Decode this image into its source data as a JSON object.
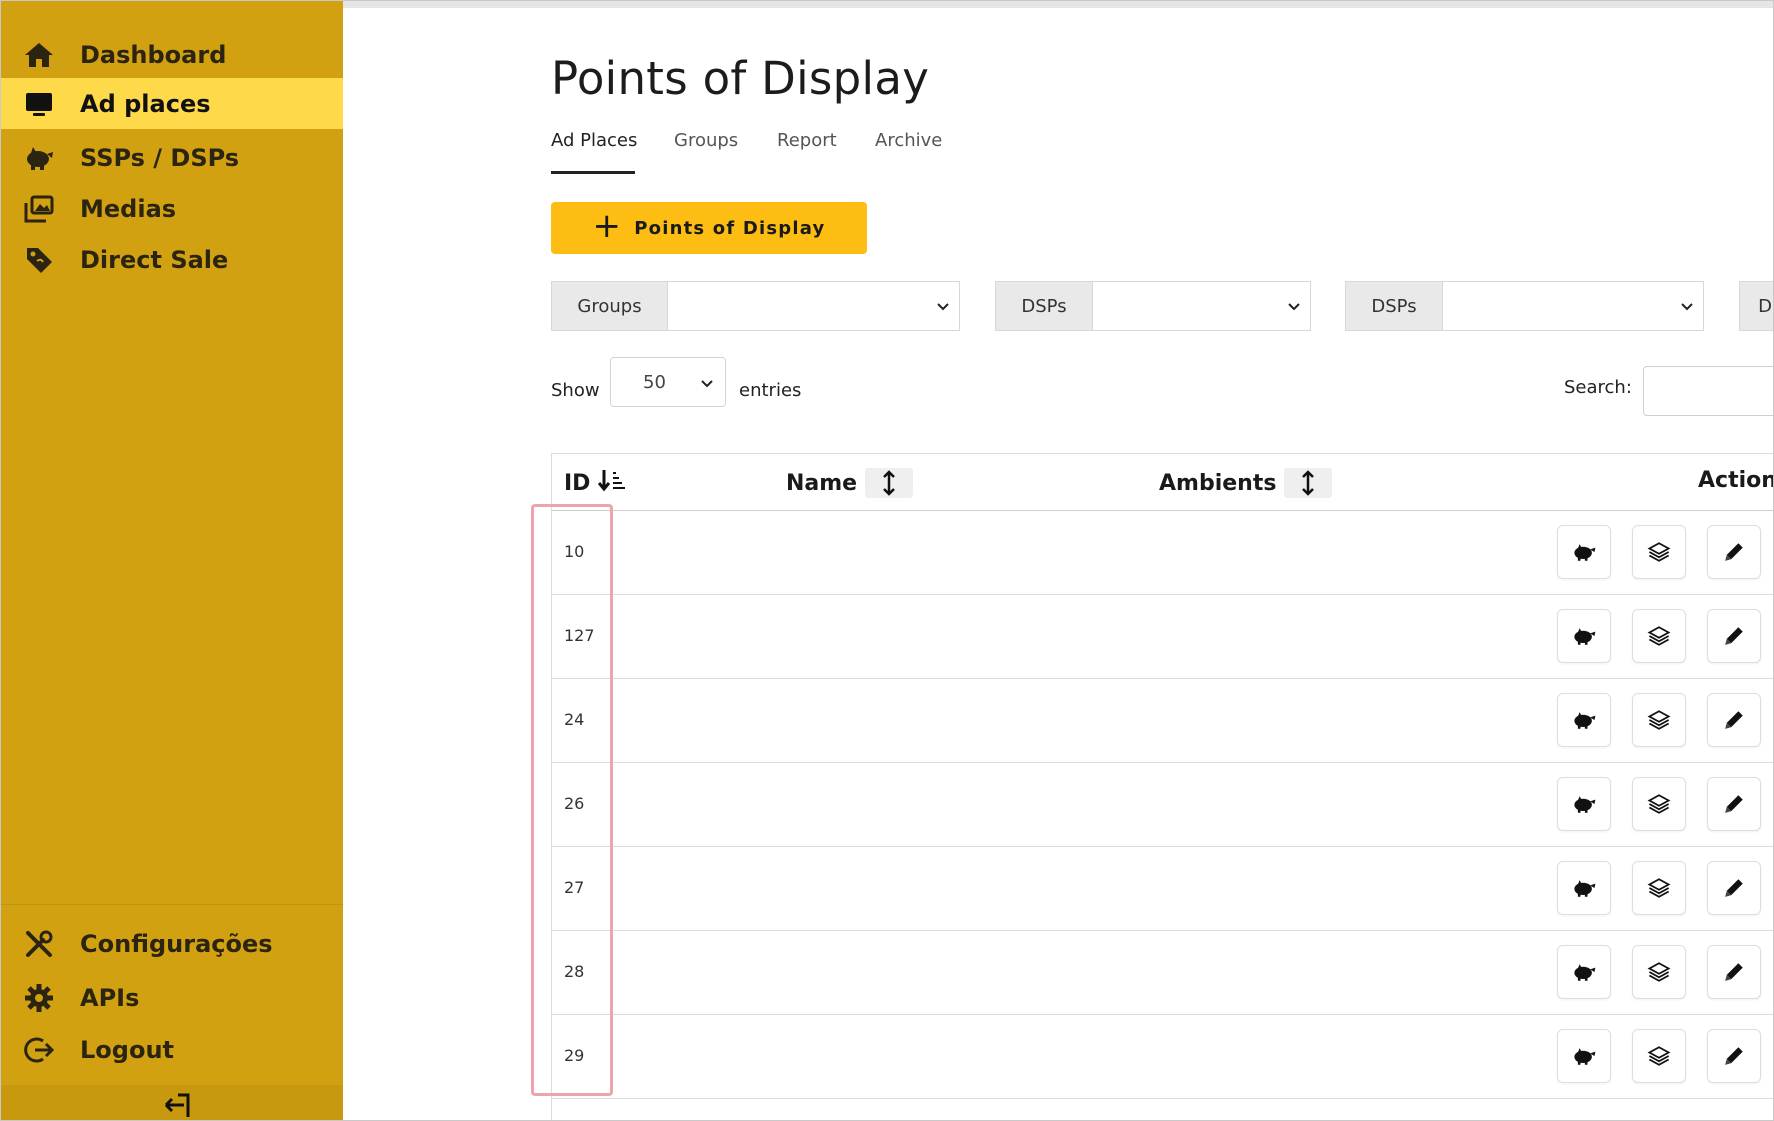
{
  "sidebar": {
    "items": [
      {
        "label": "Dashboard",
        "icon": "home-icon"
      },
      {
        "label": "Ad places",
        "icon": "monitor-icon",
        "active": true
      },
      {
        "label": "SSPs / DSPs",
        "icon": "piggy-bank-icon"
      },
      {
        "label": "Medias",
        "icon": "images-icon"
      },
      {
        "label": "Direct Sale",
        "icon": "price-tag-icon"
      }
    ],
    "bottom_items": [
      {
        "label": "Configurações",
        "icon": "tools-icon"
      },
      {
        "label": "APIs",
        "icon": "gear-icon"
      },
      {
        "label": "Logout",
        "icon": "logout-icon"
      }
    ],
    "collapse_icon": "collapse-sidebar-icon",
    "colors": {
      "background": "#d2a112",
      "active": "#fed94a"
    }
  },
  "main": {
    "title": "Points of Display",
    "tabs": [
      {
        "label": "Ad Places",
        "active": true
      },
      {
        "label": "Groups"
      },
      {
        "label": "Report"
      },
      {
        "label": "Archive"
      }
    ],
    "add_button": {
      "label": "Points of Display",
      "color": "#fdbd13"
    },
    "filters": [
      {
        "label": "Groups",
        "selected": ""
      },
      {
        "label": "DSPs",
        "selected": ""
      },
      {
        "label": "DSPs",
        "selected": ""
      },
      {
        "label": "D",
        "selected": ""
      }
    ],
    "length": {
      "show_label": "Show",
      "value": "50",
      "entries_label": "entries"
    },
    "search": {
      "label": "Search:",
      "value": ""
    },
    "table": {
      "columns": [
        "ID",
        "Name",
        "Ambients",
        "Action"
      ],
      "rows": [
        {
          "id": "10"
        },
        {
          "id": "127"
        },
        {
          "id": "24"
        },
        {
          "id": "26"
        },
        {
          "id": "27"
        },
        {
          "id": "28"
        },
        {
          "id": "29"
        }
      ],
      "row_actions": [
        "piggy-bank-icon",
        "layers-icon",
        "pencil-icon"
      ]
    },
    "highlight_color": "#f1a3ab"
  }
}
